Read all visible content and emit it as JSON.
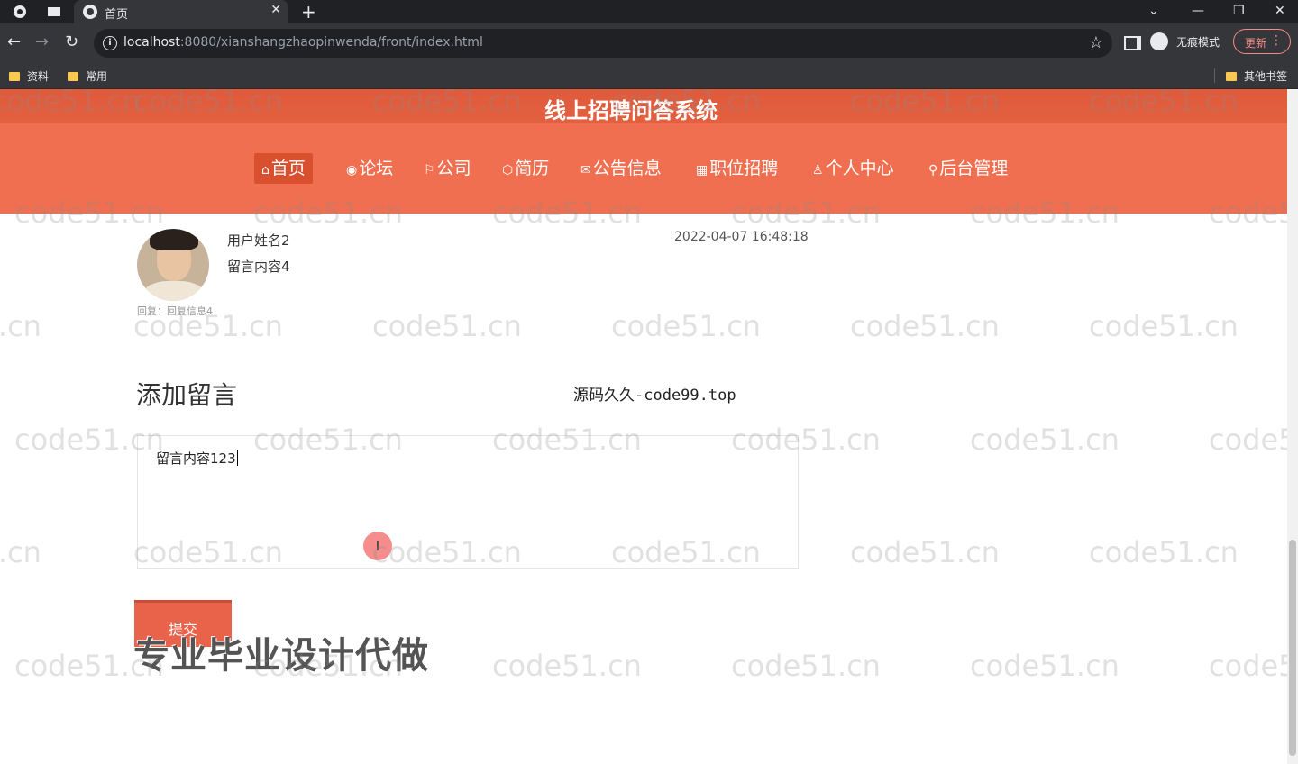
{
  "browser": {
    "tab_title": "首页",
    "tab_close": "✕",
    "new_tab": "+",
    "url_host": "localhost",
    "url_path": ":8080/xianshangzhaopinwenda/front/index.html",
    "incognito_label": "无痕模式",
    "update_label": "更新",
    "bookmarks": [
      "资料",
      "常用"
    ],
    "other_bookmarks": "其他书签"
  },
  "site": {
    "title": "线上招聘问答系统",
    "nav": [
      {
        "icon": "⌂",
        "label": "首页"
      },
      {
        "icon": "◉",
        "label": "论坛"
      },
      {
        "icon": "⚐",
        "label": "公司"
      },
      {
        "icon": "⬡",
        "label": "简历"
      },
      {
        "icon": "✉",
        "label": "公告信息"
      },
      {
        "icon": "▦",
        "label": "职位招聘"
      },
      {
        "icon": "♙",
        "label": "个人中心"
      },
      {
        "icon": "⚲",
        "label": "后台管理"
      }
    ]
  },
  "message": {
    "username": "用户姓名2",
    "content": "留言内容4",
    "time": "2022-04-07 16:48:18",
    "reply": "回复：回复信息4"
  },
  "form": {
    "title": "添加留言",
    "textarea_value": "留言内容123",
    "submit_label": "提交"
  },
  "overlay": {
    "source_watermark": "源码久久-code99.top",
    "promo_text": "专业毕业设计代做",
    "watermark": "code51.cn"
  },
  "colors": {
    "header_dark": "#e05a3c",
    "nav_bg": "#ef6f50",
    "nav_active": "#d9502f",
    "button": "#e8634a"
  }
}
